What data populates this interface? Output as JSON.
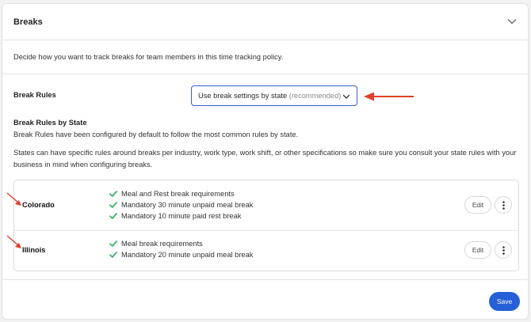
{
  "panel": {
    "title": "Breaks",
    "description": "Decide how you want to track breaks for team members in this time tracking policy."
  },
  "break_rules": {
    "label": "Break Rules",
    "selected_value": "Use break settings by state",
    "selected_hint": "(recommended)"
  },
  "by_state": {
    "title": "Break Rules by State",
    "intro": "Break Rules have been configured by default to follow the most common rules by state.",
    "note": "States can have specific rules around breaks per industry, work type, work shift, or other specifications so make sure you consult your state rules with your business in mind when configuring breaks."
  },
  "states": [
    {
      "name": "Colorado",
      "rules": [
        "Meal and Rest break requirements",
        "Mandatory 30 minute unpaid meal break",
        "Mandatory 10 minute paid rest break"
      ],
      "edit_label": "Edit"
    },
    {
      "name": "Illinois",
      "rules": [
        "Meal break requirements",
        "Mandatory 20 minute unpaid meal break"
      ],
      "edit_label": "Edit"
    }
  ],
  "footer": {
    "save_label": "Save"
  },
  "colors": {
    "accent": "#2560d8",
    "select_border": "#3a5fc7",
    "check": "#3db36b",
    "annotation_arrow": "#e0402a"
  },
  "icons": {
    "collapse": "chevron-down-icon",
    "select": "chevron-down-icon",
    "rule": "checkmark-icon",
    "more": "more-vertical-icon",
    "annotation": "arrow-icon"
  }
}
